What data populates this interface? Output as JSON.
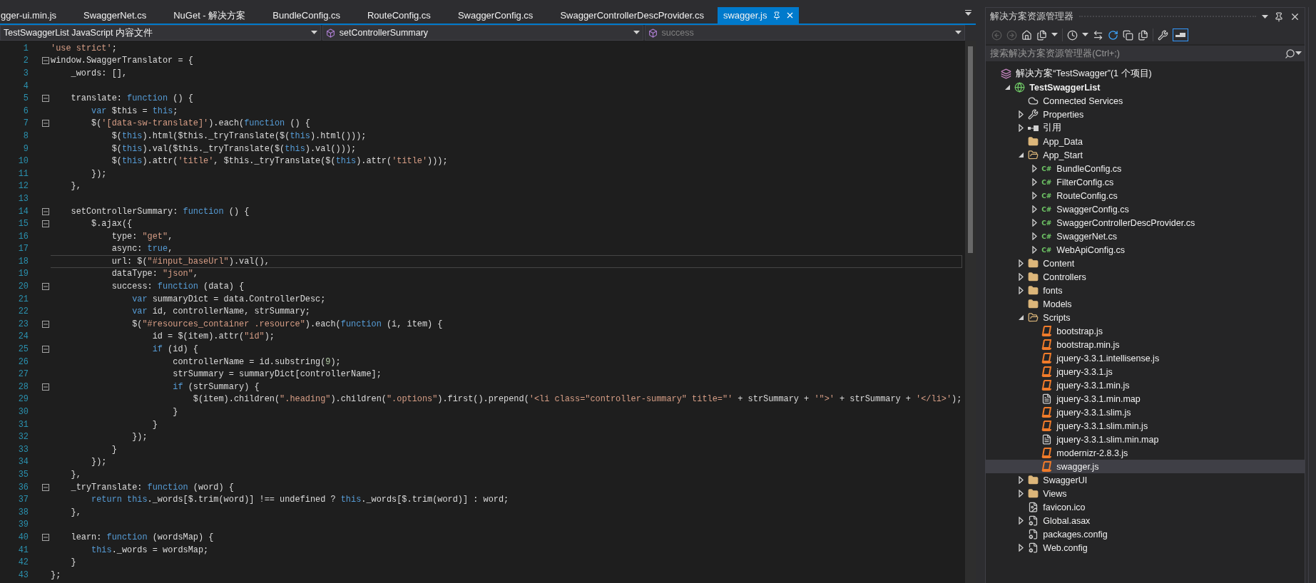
{
  "tabs": [
    {
      "label": "gger-ui.min.js",
      "selected": false
    },
    {
      "label": "SwaggerNet.cs",
      "selected": false
    },
    {
      "label": "NuGet - 解决方案",
      "selected": false
    },
    {
      "label": "BundleConfig.cs",
      "selected": false
    },
    {
      "label": "RouteConfig.cs",
      "selected": false
    },
    {
      "label": "SwaggerConfig.cs",
      "selected": false
    },
    {
      "label": "SwaggerControllerDescProvider.cs",
      "selected": false
    },
    {
      "label": "swagger.js",
      "selected": true
    }
  ],
  "nav_bar": [
    {
      "label": "TestSwaggerList JavaScript 内容文件",
      "kind": "file",
      "dimmed": false
    },
    {
      "label": "setControllerSummary",
      "kind": "member",
      "dimmed": false
    },
    {
      "label": "success",
      "kind": "member",
      "dimmed": true
    }
  ],
  "editor": {
    "lines": [
      {
        "number": "1",
        "fold": false,
        "current": false,
        "tokens": [
          {
            "kind": "string",
            "text": "'use strict'"
          },
          {
            "kind": "plain",
            "text": ";"
          }
        ]
      },
      {
        "number": "2",
        "fold": true,
        "current": false,
        "tokens": [
          {
            "kind": "plain",
            "text": "window.SwaggerTranslator = {"
          }
        ]
      },
      {
        "number": "3",
        "fold": false,
        "current": false,
        "tokens": [
          {
            "kind": "plain",
            "text": "    _words: [],"
          }
        ]
      },
      {
        "number": "4",
        "fold": false,
        "current": false
      },
      {
        "number": "5",
        "fold": true,
        "current": false,
        "tokens": [
          {
            "kind": "plain",
            "text": "    translate: "
          },
          {
            "kind": "keyword",
            "text": "function"
          },
          {
            "kind": "plain",
            "text": " () {"
          }
        ]
      },
      {
        "number": "6",
        "fold": false,
        "current": false,
        "tokens": [
          {
            "kind": "keyword",
            "text": "        var"
          },
          {
            "kind": "plain",
            "text": " $this = "
          },
          {
            "kind": "keyword",
            "text": "this"
          },
          {
            "kind": "plain",
            "text": ";"
          }
        ]
      },
      {
        "number": "7",
        "fold": true,
        "current": false,
        "tokens": [
          {
            "kind": "plain",
            "text": "        $("
          },
          {
            "kind": "string",
            "text": "'[data-sw-translate]'"
          },
          {
            "kind": "plain",
            "text": ").each("
          },
          {
            "kind": "keyword",
            "text": "function"
          },
          {
            "kind": "plain",
            "text": " () {"
          }
        ]
      },
      {
        "number": "8",
        "fold": false,
        "current": false,
        "tokens": [
          {
            "kind": "plain",
            "text": "            $("
          },
          {
            "kind": "keyword",
            "text": "this"
          },
          {
            "kind": "plain",
            "text": ").html($this._tryTranslate($("
          },
          {
            "kind": "keyword",
            "text": "this"
          },
          {
            "kind": "plain",
            "text": ").html()));"
          }
        ]
      },
      {
        "number": "9",
        "fold": false,
        "current": false,
        "tokens": [
          {
            "kind": "plain",
            "text": "            $("
          },
          {
            "kind": "keyword",
            "text": "this"
          },
          {
            "kind": "plain",
            "text": ").val($this._tryTranslate($("
          },
          {
            "kind": "keyword",
            "text": "this"
          },
          {
            "kind": "plain",
            "text": ").val()));"
          }
        ]
      },
      {
        "number": "10",
        "fold": false,
        "current": false,
        "tokens": [
          {
            "kind": "plain",
            "text": "            $("
          },
          {
            "kind": "keyword",
            "text": "this"
          },
          {
            "kind": "plain",
            "text": ").attr("
          },
          {
            "kind": "string",
            "text": "'title'"
          },
          {
            "kind": "plain",
            "text": ", $this._tryTranslate($("
          },
          {
            "kind": "keyword",
            "text": "this"
          },
          {
            "kind": "plain",
            "text": ").attr("
          },
          {
            "kind": "string",
            "text": "'title'"
          },
          {
            "kind": "plain",
            "text": ")));"
          }
        ]
      },
      {
        "number": "11",
        "fold": false,
        "current": false,
        "tokens": [
          {
            "kind": "plain",
            "text": "        });"
          }
        ]
      },
      {
        "number": "12",
        "fold": false,
        "current": false,
        "tokens": [
          {
            "kind": "plain",
            "text": "    },"
          }
        ]
      },
      {
        "number": "13",
        "fold": false,
        "current": false
      },
      {
        "number": "14",
        "fold": true,
        "current": false,
        "tokens": [
          {
            "kind": "plain",
            "text": "    setControllerSummary: "
          },
          {
            "kind": "keyword",
            "text": "function"
          },
          {
            "kind": "plain",
            "text": " () {"
          }
        ]
      },
      {
        "number": "15",
        "fold": true,
        "current": false,
        "tokens": [
          {
            "kind": "plain",
            "text": "        $.ajax({"
          }
        ]
      },
      {
        "number": "16",
        "fold": false,
        "current": false,
        "tokens": [
          {
            "kind": "plain",
            "text": "            type: "
          },
          {
            "kind": "string",
            "text": "\"get\""
          },
          {
            "kind": "plain",
            "text": ","
          }
        ]
      },
      {
        "number": "17",
        "fold": false,
        "current": false,
        "tokens": [
          {
            "kind": "plain",
            "text": "            async: "
          },
          {
            "kind": "keyword",
            "text": "true"
          },
          {
            "kind": "plain",
            "text": ","
          }
        ]
      },
      {
        "number": "18",
        "fold": false,
        "current": true,
        "tokens": [
          {
            "kind": "plain",
            "text": "            url: $("
          },
          {
            "kind": "string",
            "text": "\"#input_baseUrl\""
          },
          {
            "kind": "plain",
            "text": ").val(),"
          }
        ]
      },
      {
        "number": "19",
        "fold": false,
        "current": false,
        "tokens": [
          {
            "kind": "plain",
            "text": "            dataType: "
          },
          {
            "kind": "string",
            "text": "\"json\""
          },
          {
            "kind": "plain",
            "text": ","
          }
        ]
      },
      {
        "number": "20",
        "fold": true,
        "current": false,
        "tokens": [
          {
            "kind": "plain",
            "text": "            success: "
          },
          {
            "kind": "keyword",
            "text": "function"
          },
          {
            "kind": "plain",
            "text": " (data) {"
          }
        ]
      },
      {
        "number": "21",
        "fold": false,
        "current": false,
        "tokens": [
          {
            "kind": "keyword",
            "text": "                var"
          },
          {
            "kind": "plain",
            "text": " summaryDict = data.ControllerDesc;"
          }
        ]
      },
      {
        "number": "22",
        "fold": false,
        "current": false,
        "tokens": [
          {
            "kind": "keyword",
            "text": "                var"
          },
          {
            "kind": "plain",
            "text": " id, controllerName, strSummary;"
          }
        ]
      },
      {
        "number": "23",
        "fold": true,
        "current": false,
        "tokens": [
          {
            "kind": "plain",
            "text": "                $("
          },
          {
            "kind": "string",
            "text": "\"#resources_container .resource\""
          },
          {
            "kind": "plain",
            "text": ").each("
          },
          {
            "kind": "keyword",
            "text": "function"
          },
          {
            "kind": "plain",
            "text": " (i, item) {"
          }
        ]
      },
      {
        "number": "24",
        "fold": false,
        "current": false,
        "tokens": [
          {
            "kind": "plain",
            "text": "                    id = $(item).attr("
          },
          {
            "kind": "string",
            "text": "\"id\""
          },
          {
            "kind": "plain",
            "text": ");"
          }
        ]
      },
      {
        "number": "25",
        "fold": true,
        "current": false,
        "tokens": [
          {
            "kind": "keyword",
            "text": "                    if"
          },
          {
            "kind": "plain",
            "text": " (id) {"
          }
        ]
      },
      {
        "number": "26",
        "fold": false,
        "current": false,
        "tokens": [
          {
            "kind": "plain",
            "text": "                        controllerName = id.substring("
          },
          {
            "kind": "number",
            "text": "9"
          },
          {
            "kind": "plain",
            "text": ");"
          }
        ]
      },
      {
        "number": "27",
        "fold": false,
        "current": false,
        "tokens": [
          {
            "kind": "plain",
            "text": "                        strSummary = summaryDict[controllerName];"
          }
        ]
      },
      {
        "number": "28",
        "fold": true,
        "current": false,
        "tokens": [
          {
            "kind": "keyword",
            "text": "                        if"
          },
          {
            "kind": "plain",
            "text": " (strSummary) {"
          }
        ]
      },
      {
        "number": "29",
        "fold": false,
        "current": false,
        "tokens": [
          {
            "kind": "plain",
            "text": "                            $(item).children("
          },
          {
            "kind": "string",
            "text": "\".heading\""
          },
          {
            "kind": "plain",
            "text": ").children("
          },
          {
            "kind": "string",
            "text": "\".options\""
          },
          {
            "kind": "plain",
            "text": ").first().prepend("
          },
          {
            "kind": "string",
            "text": "'<li class=\"controller-summary\" title=\"'"
          },
          {
            "kind": "plain",
            "text": " + strSummary + "
          },
          {
            "kind": "string",
            "text": "'\">'"
          },
          {
            "kind": "plain",
            "text": " + strSummary + "
          },
          {
            "kind": "string",
            "text": "'</li>'"
          },
          {
            "kind": "plain",
            "text": ");"
          }
        ]
      },
      {
        "number": "30",
        "fold": false,
        "current": false,
        "tokens": [
          {
            "kind": "plain",
            "text": "                        }"
          }
        ]
      },
      {
        "number": "31",
        "fold": false,
        "current": false,
        "tokens": [
          {
            "kind": "plain",
            "text": "                    }"
          }
        ]
      },
      {
        "number": "32",
        "fold": false,
        "current": false,
        "tokens": [
          {
            "kind": "plain",
            "text": "                });"
          }
        ]
      },
      {
        "number": "33",
        "fold": false,
        "current": false,
        "tokens": [
          {
            "kind": "plain",
            "text": "            }"
          }
        ]
      },
      {
        "number": "34",
        "fold": false,
        "current": false,
        "tokens": [
          {
            "kind": "plain",
            "text": "        });"
          }
        ]
      },
      {
        "number": "35",
        "fold": false,
        "current": false,
        "tokens": [
          {
            "kind": "plain",
            "text": "    },"
          }
        ]
      },
      {
        "number": "36",
        "fold": true,
        "current": false,
        "tokens": [
          {
            "kind": "plain",
            "text": "    _tryTranslate: "
          },
          {
            "kind": "keyword",
            "text": "function"
          },
          {
            "kind": "plain",
            "text": " (word) {"
          }
        ]
      },
      {
        "number": "37",
        "fold": false,
        "current": false,
        "tokens": [
          {
            "kind": "keyword",
            "text": "        return this"
          },
          {
            "kind": "plain",
            "text": "._words[$.trim(word)] !== undefined ? "
          },
          {
            "kind": "keyword",
            "text": "this"
          },
          {
            "kind": "plain",
            "text": "._words[$.trim(word)] : word;"
          }
        ]
      },
      {
        "number": "38",
        "fold": false,
        "current": false,
        "tokens": [
          {
            "kind": "plain",
            "text": "    },"
          }
        ]
      },
      {
        "number": "39",
        "fold": false,
        "current": false
      },
      {
        "number": "40",
        "fold": true,
        "current": false,
        "tokens": [
          {
            "kind": "plain",
            "text": "    learn: "
          },
          {
            "kind": "keyword",
            "text": "function"
          },
          {
            "kind": "plain",
            "text": " (wordsMap) {"
          }
        ]
      },
      {
        "number": "41",
        "fold": false,
        "current": false,
        "tokens": [
          {
            "kind": "keyword",
            "text": "        this"
          },
          {
            "kind": "plain",
            "text": "._words = wordsMap;"
          }
        ]
      },
      {
        "number": "42",
        "fold": false,
        "current": false,
        "tokens": [
          {
            "kind": "plain",
            "text": "    }"
          }
        ]
      },
      {
        "number": "43",
        "fold": false,
        "current": false,
        "tokens": [
          {
            "kind": "plain",
            "text": "};"
          }
        ]
      }
    ]
  },
  "explorer": {
    "title": "解决方案资源管理器",
    "search_placeholder": "搜索解决方案资源管理器(Ctrl+;)",
    "tree": [
      {
        "label": "解决方案“TestSwagger”(1 个项目)",
        "kind": "solution",
        "expandable": false,
        "selected": false,
        "children": [
          {
            "label": "TestSwaggerList",
            "kind": "project",
            "expandable": true,
            "expanded": true,
            "selected": false,
            "children": [
              {
                "label": "Connected Services",
                "kind": "service",
                "expandable": false,
                "selected": false
              },
              {
                "label": "Properties",
                "kind": "properties",
                "expandable": true,
                "expanded": false,
                "selected": false
              },
              {
                "label": "引用",
                "kind": "references",
                "expandable": true,
                "expanded": false,
                "selected": false
              },
              {
                "label": "App_Data",
                "kind": "folder",
                "expandable": false,
                "selected": false
              },
              {
                "label": "App_Start",
                "kind": "open-folder",
                "expandable": true,
                "expanded": true,
                "selected": false,
                "children": [
                  {
                    "label": "BundleConfig.cs",
                    "kind": "source",
                    "icon_text": "C#",
                    "expandable": true,
                    "expanded": false,
                    "selected": false
                  },
                  {
                    "label": "FilterConfig.cs",
                    "kind": "source",
                    "icon_text": "C#",
                    "expandable": true,
                    "expanded": false,
                    "selected": false
                  },
                  {
                    "label": "RouteConfig.cs",
                    "kind": "source",
                    "icon_text": "C#",
                    "expandable": true,
                    "expanded": false,
                    "selected": false
                  },
                  {
                    "label": "SwaggerConfig.cs",
                    "kind": "source",
                    "icon_text": "C#",
                    "expandable": true,
                    "expanded": false,
                    "selected": false
                  },
                  {
                    "label": "SwaggerControllerDescProvider.cs",
                    "kind": "source",
                    "icon_text": "C#",
                    "expandable": true,
                    "expanded": false,
                    "selected": false
                  },
                  {
                    "label": "SwaggerNet.cs",
                    "kind": "source",
                    "icon_text": "C#",
                    "expandable": true,
                    "expanded": false,
                    "selected": false
                  },
                  {
                    "label": "WebApiConfig.cs",
                    "kind": "source",
                    "icon_text": "C#",
                    "expandable": true,
                    "expanded": false,
                    "selected": false
                  }
                ]
              },
              {
                "label": "Content",
                "kind": "folder",
                "expandable": true,
                "expanded": false,
                "selected": false
              },
              {
                "label": "Controllers",
                "kind": "folder",
                "expandable": true,
                "expanded": false,
                "selected": false
              },
              {
                "label": "fonts",
                "kind": "folder",
                "expandable": true,
                "expanded": false,
                "selected": false
              },
              {
                "label": "Models",
                "kind": "folder",
                "expandable": false,
                "selected": false
              },
              {
                "label": "Scripts",
                "kind": "open-folder",
                "expandable": true,
                "expanded": true,
                "selected": false,
                "children": [
                  {
                    "label": "bootstrap.js",
                    "kind": "script",
                    "expandable": false,
                    "selected": false
                  },
                  {
                    "label": "bootstrap.min.js",
                    "kind": "script",
                    "expandable": false,
                    "selected": false
                  },
                  {
                    "label": "jquery-3.3.1.intellisense.js",
                    "kind": "script",
                    "expandable": false,
                    "selected": false
                  },
                  {
                    "label": "jquery-3.3.1.js",
                    "kind": "script",
                    "expandable": false,
                    "selected": false
                  },
                  {
                    "label": "jquery-3.3.1.min.js",
                    "kind": "script",
                    "expandable": false,
                    "selected": false
                  },
                  {
                    "label": "jquery-3.3.1.min.map",
                    "kind": "document",
                    "expandable": false,
                    "selected": false
                  },
                  {
                    "label": "jquery-3.3.1.slim.js",
                    "kind": "script",
                    "expandable": false,
                    "selected": false
                  },
                  {
                    "label": "jquery-3.3.1.slim.min.js",
                    "kind": "script",
                    "expandable": false,
                    "selected": false
                  },
                  {
                    "label": "jquery-3.3.1.slim.min.map",
                    "kind": "document",
                    "expandable": false,
                    "selected": false
                  },
                  {
                    "label": "modernizr-2.8.3.js",
                    "kind": "script",
                    "expandable": false,
                    "selected": false
                  },
                  {
                    "label": "swagger.js",
                    "kind": "script",
                    "expandable": false,
                    "selected": true
                  }
                ]
              },
              {
                "label": "SwaggerUI",
                "kind": "folder",
                "expandable": true,
                "expanded": false,
                "selected": false
              },
              {
                "label": "Views",
                "kind": "folder",
                "expandable": true,
                "expanded": false,
                "selected": false
              },
              {
                "label": "favicon.ico",
                "kind": "image",
                "expandable": false,
                "selected": false
              },
              {
                "label": "Global.asax",
                "kind": "global",
                "expandable": true,
                "expanded": false,
                "selected": false
              },
              {
                "label": "packages.config",
                "kind": "config",
                "expandable": false,
                "selected": false
              },
              {
                "label": "Web.config",
                "kind": "config",
                "expandable": true,
                "expanded": false,
                "selected": false
              }
            ]
          }
        ]
      }
    ]
  }
}
